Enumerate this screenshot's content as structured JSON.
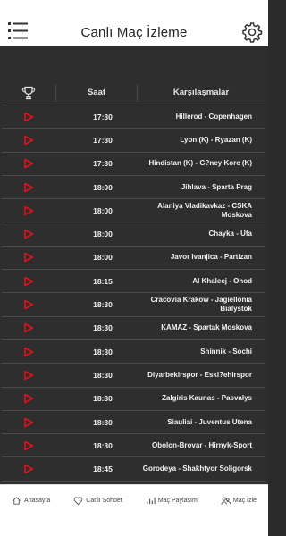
{
  "header": {
    "title": "Canlı Maç İzleme"
  },
  "table": {
    "col_time": "Saat",
    "col_match": "Karşılaşmalar",
    "rows": [
      {
        "time": "17:30",
        "match": "Hillerod - Copenhagen"
      },
      {
        "time": "17:30",
        "match": "Lyon (K) - Ryazan (K)"
      },
      {
        "time": "17:30",
        "match": "Hindistan (K) - G?ney Kore (K)"
      },
      {
        "time": "18:00",
        "match": "Jihlava - Sparta Prag"
      },
      {
        "time": "18:00",
        "match": "Alaniya Vladikavkaz - CSKA Moskova"
      },
      {
        "time": "18:00",
        "match": "Chayka - Ufa"
      },
      {
        "time": "18:00",
        "match": "Javor Ivanjica - Partizan"
      },
      {
        "time": "18:15",
        "match": "Al Khaleej - Ohod"
      },
      {
        "time": "18:30",
        "match": "Cracovia Krakow - Jagiellonia Bialystok"
      },
      {
        "time": "18:30",
        "match": "KAMAZ - Spartak Moskova"
      },
      {
        "time": "18:30",
        "match": "Shinnik - Sochi"
      },
      {
        "time": "18:30",
        "match": "Diyarbekirspor - Eski?ehirspor"
      },
      {
        "time": "18:30",
        "match": "Zalgiris Kaunas - Pasvalys"
      },
      {
        "time": "18:30",
        "match": "Siauliai - Juventus Utena"
      },
      {
        "time": "18:30",
        "match": "Obolon-Brovar - Hirnyk-Sport"
      },
      {
        "time": "18:45",
        "match": "Gorodeya - Shakhtyor Soligorsk"
      }
    ]
  },
  "nav": {
    "home": "Anasayfa",
    "chat": "Canlı Sohbet",
    "share": "Maç Paylaşım",
    "watch": "Maç İzle"
  },
  "colors": {
    "play": "#e0121a",
    "background": "#2e2e2e",
    "accent": "#ffffff"
  }
}
